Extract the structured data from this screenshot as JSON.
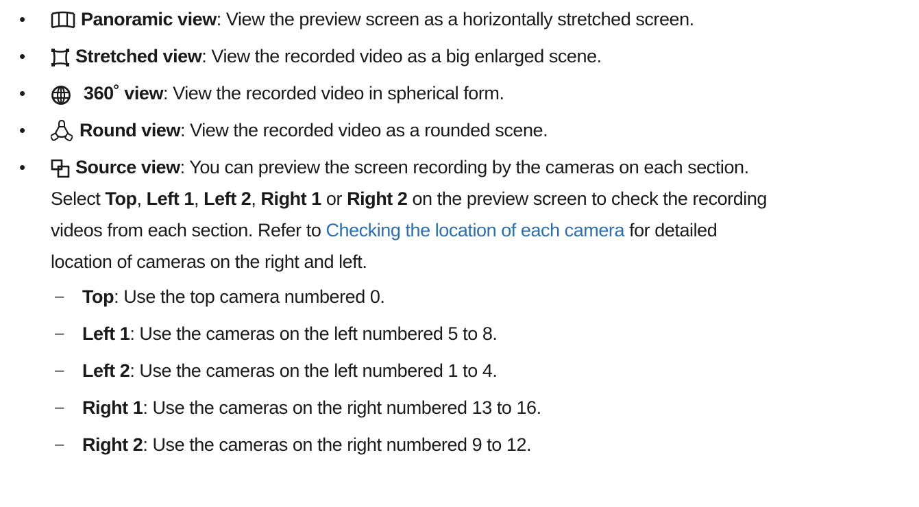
{
  "colors": {
    "text": "#1a1a1a",
    "link": "#2a6fb5"
  },
  "bullets": [
    {
      "icon": "panoramic-icon",
      "term": "Panoramic view",
      "sep": ":",
      "desc": " View the preview screen as a horizontally stretched screen."
    },
    {
      "icon": "stretched-icon",
      "term": "Stretched view",
      "sep": ":",
      "desc": " View the recorded video as a big enlarged scene."
    },
    {
      "icon": "sphere-360-icon",
      "term": "360˚ view",
      "sep": ":",
      "desc": " View the recorded video in spherical form."
    },
    {
      "icon": "round-view-icon",
      "term": "Round view",
      "sep": ":",
      "desc": " View the recorded video as a rounded scene."
    },
    {
      "icon": "source-view-icon",
      "term": "Source view",
      "sep": ":",
      "desc": " You can preview the screen recording by the cameras on each section.",
      "line2": {
        "pre": "Select ",
        "top": "Top",
        "comma1": ", ",
        "left1": "Left 1",
        "comma2": ", ",
        "left2": "Left 2",
        "comma3": ", ",
        "right1": "Right 1",
        "or": " or ",
        "right2": "Right 2",
        "post": " on the preview screen to check the recording"
      },
      "line3": {
        "pre": "videos from each section. Refer to ",
        "link": "Checking the location of each camera",
        "post": " for detailed"
      },
      "line4": "location of cameras on the right and left."
    }
  ],
  "sub_items": [
    {
      "dash": "–",
      "term": "Top",
      "sep": ":",
      "desc": " Use the top camera numbered 0."
    },
    {
      "dash": "–",
      "term": "Left 1",
      "sep": ":",
      "desc": " Use the cameras on the left numbered 5 to 8."
    },
    {
      "dash": "–",
      "term": "Left 2",
      "sep": ":",
      "desc": " Use the cameras on the left numbered 1 to 4."
    },
    {
      "dash": "–",
      "term": "Right 1",
      "sep": ":",
      "desc": " Use the cameras on the right numbered 13 to 16."
    },
    {
      "dash": "–",
      "term": "Right 2",
      "sep": ":",
      "desc": " Use the cameras on the right numbered 9 to 12."
    }
  ]
}
